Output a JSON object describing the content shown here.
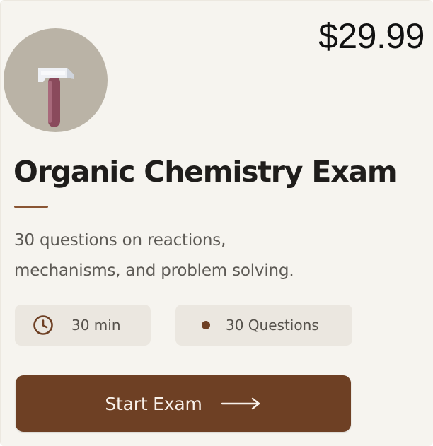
{
  "card": {
    "icon": "test-tube-icon",
    "price": "$29.99",
    "title": "Organic Chemistry Exam",
    "description_line1": "30 questions on reactions,",
    "description_line2": "mechanisms, and problem solving.",
    "meta": {
      "duration": "30 min",
      "duration_icon": "clock-icon",
      "questions": "30 Questions",
      "questions_icon": "dot-icon"
    },
    "start_button": {
      "label": "Start Exam",
      "icon": "arrow-right-icon"
    }
  },
  "colors": {
    "background": "#f6f4ef",
    "accent": "#6e4024",
    "avatar_bg": "#bab3a6",
    "pill_bg": "#ebe7e0",
    "title_text": "#1f1d1b"
  }
}
